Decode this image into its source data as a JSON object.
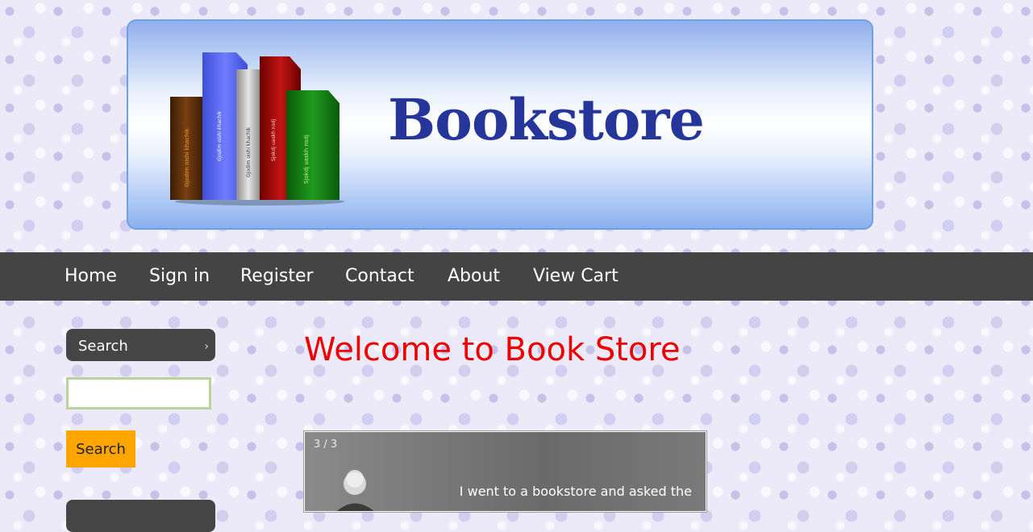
{
  "header": {
    "site_title": "Bookstore",
    "book_spines": [
      "Gjodim oishi khachik",
      "Gjodim oishi khachik",
      "Gjodim oishi khachik",
      "Sjokdj uaskh nsdj",
      "Sjokdj uaskh nsdj"
    ]
  },
  "nav": {
    "items": [
      {
        "label": "Home"
      },
      {
        "label": "Sign in"
      },
      {
        "label": "Register"
      },
      {
        "label": "Contact"
      },
      {
        "label": "About"
      },
      {
        "label": "View Cart"
      }
    ]
  },
  "sidebar": {
    "search_header": "Search",
    "search_placeholder": "",
    "search_button_label": "Search"
  },
  "main": {
    "welcome_heading": "Welcome to Book Store",
    "slideshow": {
      "counter": "3 / 3",
      "quote_visible": "I went to a bookstore and asked the"
    }
  },
  "colors": {
    "accent_button": "#ffa500",
    "nav_background": "#444444",
    "heading_red": "#ee0000",
    "title_blue": "#25359a"
  }
}
